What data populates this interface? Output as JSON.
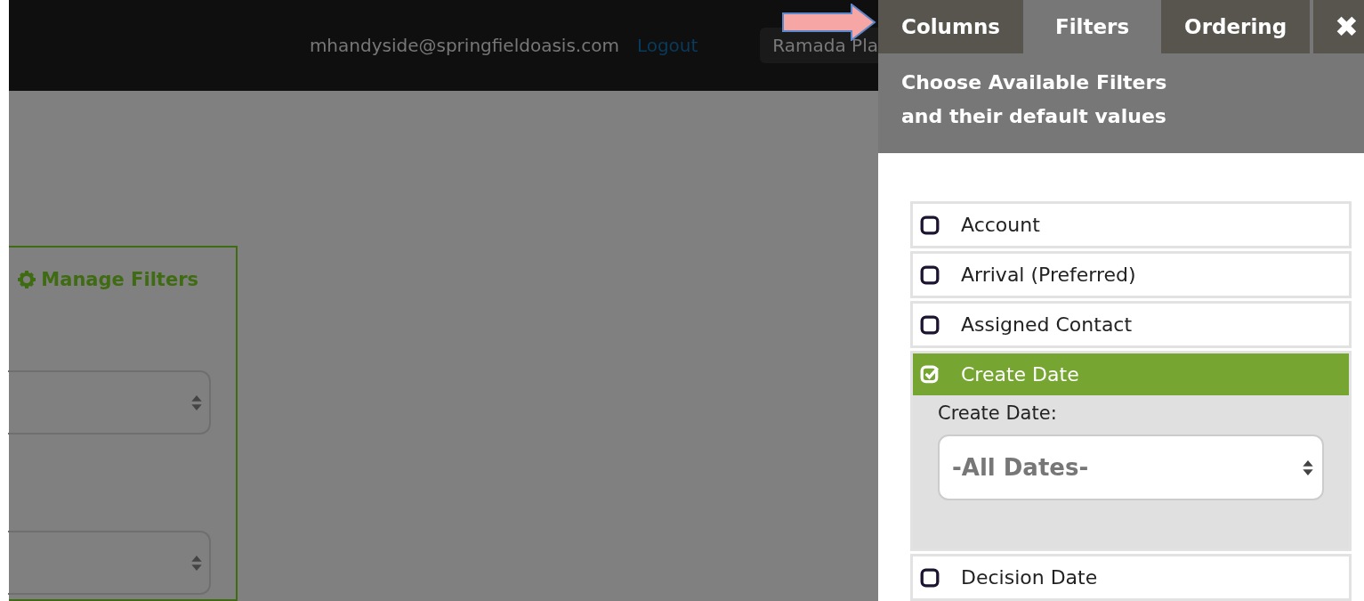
{
  "top_bar": {
    "email": "mhandyside@springfieldoasis.com",
    "logout": "Logout",
    "property": "Ramada Pla"
  },
  "filters_box": {
    "title": "Manage Filters"
  },
  "panel": {
    "tabs": [
      {
        "label": "Columns",
        "selected": false
      },
      {
        "label": "Filters",
        "selected": true
      },
      {
        "label": "Ordering",
        "selected": false
      }
    ],
    "close": "✖",
    "heading": [
      "Choose Available Filters",
      "and their default values"
    ],
    "filters": [
      {
        "label": "Account",
        "checked": false
      },
      {
        "label": "Arrival (Preferred)",
        "checked": false
      },
      {
        "label": "Assigned Contact",
        "checked": false
      },
      {
        "label": "Create Date",
        "checked": true,
        "detail": {
          "label": "Create Date:",
          "value": "-All Dates-"
        }
      },
      {
        "label": "Decision Date",
        "checked": false
      }
    ]
  }
}
